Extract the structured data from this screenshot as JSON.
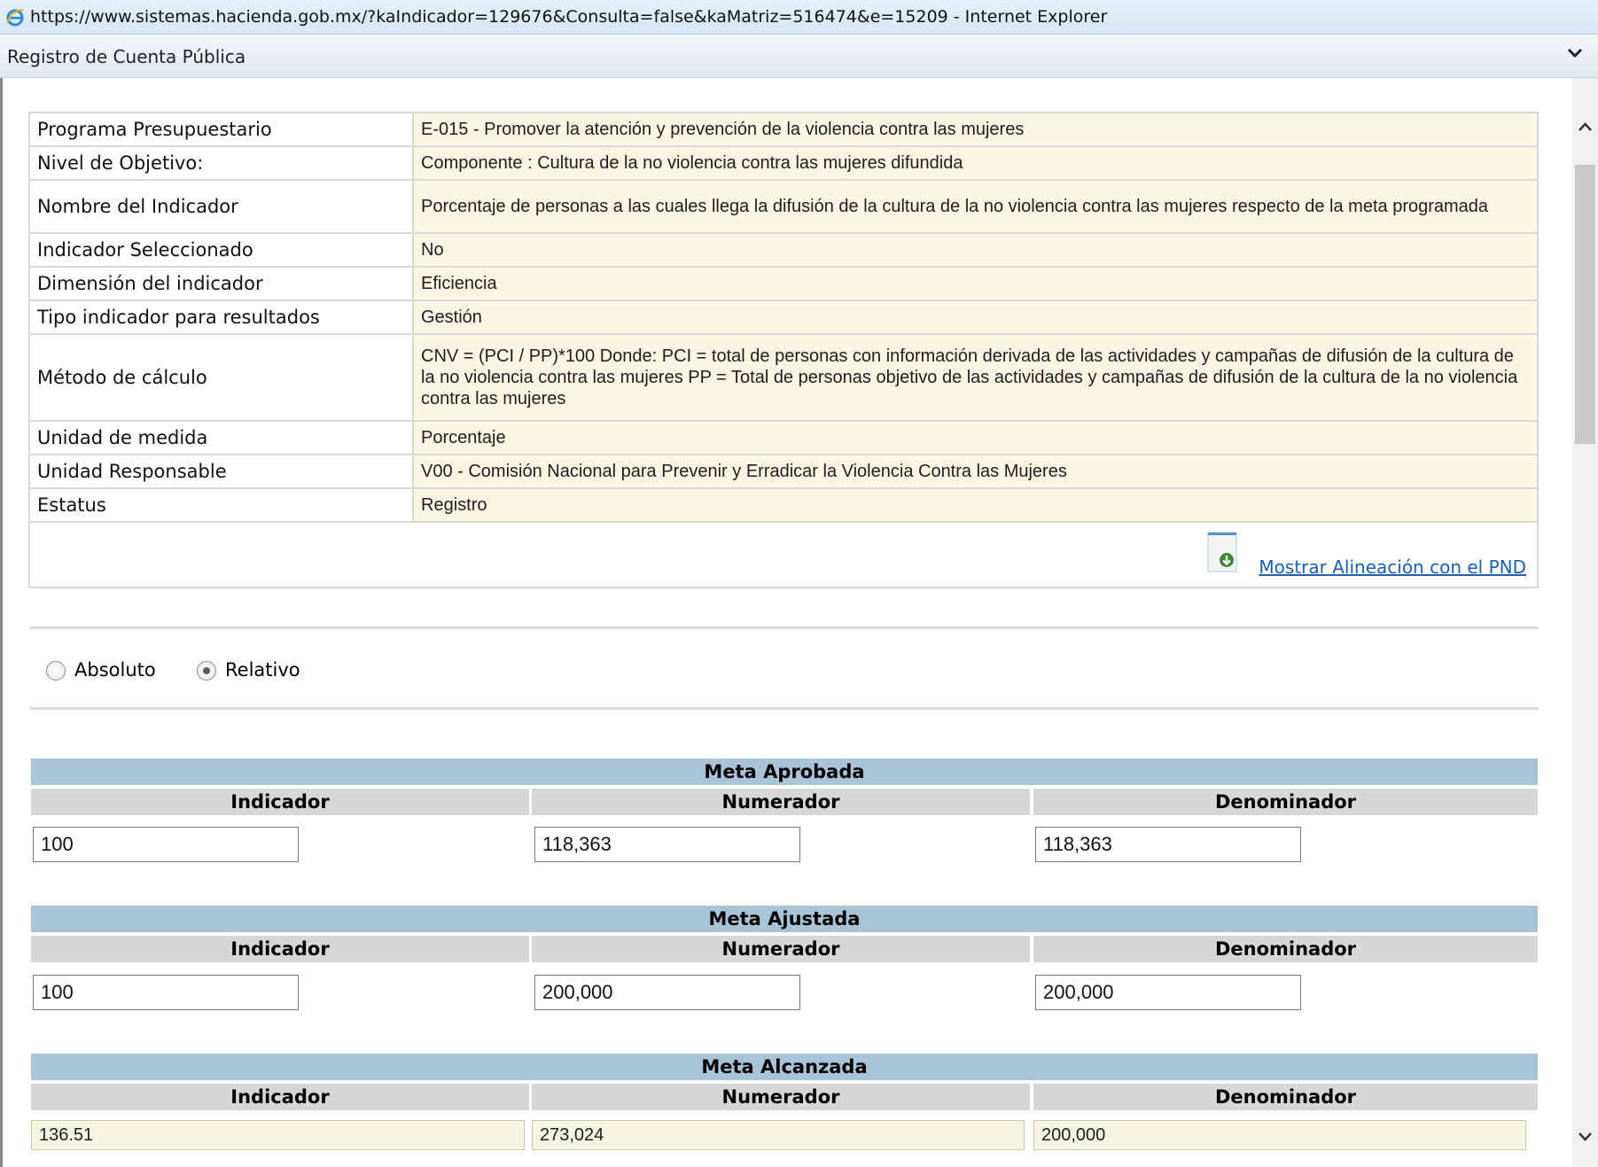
{
  "window": {
    "title": "https://www.sistemas.hacienda.gob.mx/?kaIndicador=129676&Consulta=false&kaMatriz=516474&e=15209 - Internet Explorer"
  },
  "panel": {
    "title": "Registro de Cuenta Pública"
  },
  "info": {
    "rows": [
      {
        "label": "Programa Presupuestario",
        "value": "E-015 - Promover la atención y prevención de la violencia contra las mujeres"
      },
      {
        "label": "Nivel de Objetivo:",
        "value": "Componente : Cultura de la no violencia contra las mujeres difundida"
      },
      {
        "label": "Nombre del Indicador",
        "value": "Porcentaje de personas a las cuales llega la difusión de la cultura de la no violencia contra las mujeres respecto de la meta programada"
      },
      {
        "label": "Indicador Seleccionado",
        "value": "No"
      },
      {
        "label": "Dimensión del indicador",
        "value": "Eficiencia"
      },
      {
        "label": "Tipo indicador para resultados",
        "value": "Gestión"
      },
      {
        "label": "Método de cálculo",
        "value": "CNV = (PCI / PP)*100 Donde: PCI = total de personas con información derivada de las actividades y campañas de difusión de la cultura de la no violencia contra las mujeres PP = Total de personas objetivo de las actividades y campañas de difusión de la cultura de la no violencia contra las mujeres"
      },
      {
        "label": "Unidad de medida",
        "value": "Porcentaje"
      },
      {
        "label": "Unidad Responsable",
        "value": "V00 - Comisión Nacional para Prevenir y Erradicar la Violencia Contra las Mujeres"
      },
      {
        "label": "Estatus",
        "value": "Registro"
      }
    ],
    "link": "Mostrar Alineación con el PND"
  },
  "mode": {
    "options": [
      "Absoluto",
      "Relativo"
    ],
    "selected": "Relativo"
  },
  "columns": {
    "indicador": "Indicador",
    "numerador": "Numerador",
    "denominador": "Denominador"
  },
  "metas": {
    "aprobada": {
      "title": "Meta Aprobada",
      "indicador": "100",
      "numerador": "118,363",
      "denominador": "118,363"
    },
    "ajustada": {
      "title": "Meta Ajustada",
      "indicador": "100",
      "numerador": "200,000",
      "denominador": "200,000"
    },
    "alcanzada": {
      "title": "Meta Alcanzada",
      "indicador": "136.51",
      "numerador": "273,024",
      "denominador": "200,000"
    }
  },
  "colors": {
    "section_header": "#a9c4d6",
    "column_header": "#d7d7d7",
    "readonly_field": "#f7f7e4",
    "link": "#1a5fb4"
  }
}
